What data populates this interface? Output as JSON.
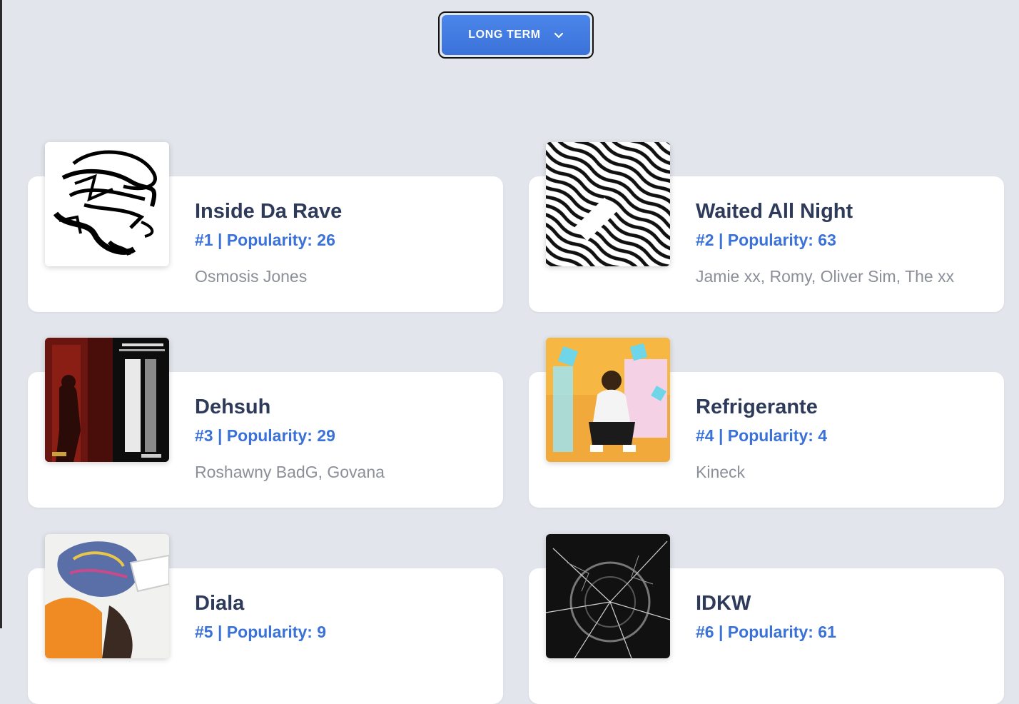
{
  "colors": {
    "background": "#e2e6ec",
    "accent": "#3b72d9",
    "title": "#2e3a59",
    "artist": "#8b8f98",
    "card": "#ffffff"
  },
  "term_selector": {
    "label": "LONG TERM",
    "icon": "chevron-down-icon"
  },
  "tracks": [
    {
      "title": "Inside Da Rave",
      "rank_line": "#1 | Popularity: 26",
      "artists": "Osmosis Jones",
      "art": "graffiti-cover"
    },
    {
      "title": "Waited All Night",
      "rank_line": "#2 | Popularity: 63",
      "artists": "Jamie xx, Romy, Oliver Sim, The xx",
      "art": "op-art-cover"
    },
    {
      "title": "Dehsuh",
      "rank_line": "#3 | Popularity: 29",
      "artists": "Roshawny BadG, Govana",
      "art": "red-poster-cover"
    },
    {
      "title": "Refrigerante",
      "rank_line": "#4 | Popularity: 4",
      "artists": "Kineck",
      "art": "colorful-photo-cover"
    },
    {
      "title": "Diala",
      "rank_line": "#5 | Popularity: 9",
      "artists": "",
      "art": "abstract-cover"
    },
    {
      "title": "IDKW",
      "rank_line": "#6 | Popularity: 61",
      "artists": "",
      "art": "shattered-glass-cover"
    }
  ]
}
